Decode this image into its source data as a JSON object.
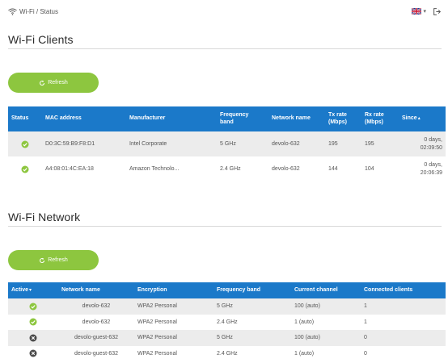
{
  "breadcrumb": "Wi-Fi / Status",
  "colors": {
    "accent": "#1b79c9",
    "button": "#8dc63f",
    "ok": "#8dc63f",
    "off": "#4a4a4a"
  },
  "clients": {
    "title": "Wi-Fi Clients",
    "refresh_label": "Refresh",
    "headers": {
      "status": "Status",
      "mac": "MAC address",
      "manufacturer": "Manufacturer",
      "band_line1": "Frequency",
      "band_line2": "band",
      "network": "Network name",
      "tx_line1": "Tx rate",
      "tx_line2": "(Mbps)",
      "rx_line1": "Rx rate",
      "rx_line2": "(Mbps)",
      "since": "Since",
      "since_sort": "▴"
    },
    "rows": [
      {
        "status": "connected",
        "mac": "D0:3C:59:B9:F8:D1",
        "manufacturer": "Intel Corporate",
        "band": "5 GHz",
        "network": "devolo-632",
        "tx": "195",
        "rx": "195",
        "since_line1": "0 days,",
        "since_line2": "02:09:50"
      },
      {
        "status": "connected",
        "mac": "A4:08:01:4C:EA:18",
        "manufacturer": "Amazon Technolo...",
        "band": "2.4 GHz",
        "network": "devolo-632",
        "tx": "144",
        "rx": "104",
        "since_line1": "0 days,",
        "since_line2": "20:06:39"
      }
    ]
  },
  "network": {
    "title": "Wi-Fi Network",
    "refresh_label": "Refresh",
    "headers": {
      "active": "Active",
      "active_sort": "▾",
      "name": "Network name",
      "encryption": "Encryption",
      "band": "Frequency band",
      "channel": "Current channel",
      "clients": "Connected clients"
    },
    "rows": [
      {
        "status": "active",
        "name": "devolo-632",
        "encryption": "WPA2 Personal",
        "band": "5 GHz",
        "channel": "100 (auto)",
        "clients": "1"
      },
      {
        "status": "active",
        "name": "devolo-632",
        "encryption": "WPA2 Personal",
        "band": "2.4 GHz",
        "channel": "1 (auto)",
        "clients": "1"
      },
      {
        "status": "inactive",
        "name": "devolo-guest-632",
        "encryption": "WPA2 Personal",
        "band": "5 GHz",
        "channel": "100 (auto)",
        "clients": "0"
      },
      {
        "status": "inactive",
        "name": "devolo-guest-632",
        "encryption": "WPA2 Personal",
        "band": "2.4 GHz",
        "channel": "1 (auto)",
        "clients": "0"
      }
    ]
  }
}
